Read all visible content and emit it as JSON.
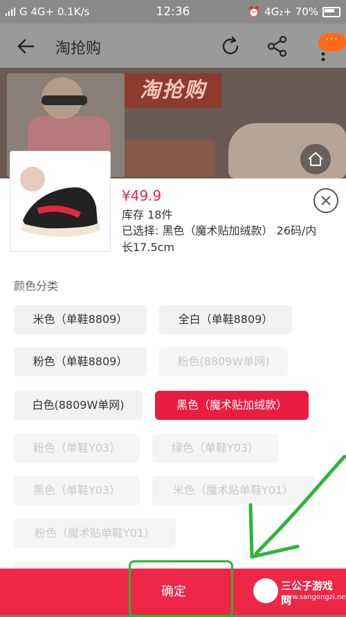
{
  "status": {
    "left_text": "G 4G+ 0.1K/s",
    "time": "12:36",
    "right_text": "4G₂+ 70%"
  },
  "header": {
    "title": "淘抢购"
  },
  "banner": {
    "logo_text": "淘抢购"
  },
  "product": {
    "price": "¥49.9",
    "stock": "库存 18件",
    "selected": "已选择: 黑色（魔术贴加绒款）  26码/内长17.5cm"
  },
  "section": {
    "label": "颜色分类"
  },
  "options": [
    {
      "label": "米色（单鞋8809）",
      "state": "normal"
    },
    {
      "label": "全白（单鞋8809）",
      "state": "normal"
    },
    {
      "label": "粉色（单鞋8809）",
      "state": "normal"
    },
    {
      "label": "粉色(8809W单网)",
      "state": "disabled"
    },
    {
      "label": "白色(8809W单网)",
      "state": "normal"
    },
    {
      "label": "黑色（魔术贴加绒款）",
      "state": "active"
    },
    {
      "label": "粉色（单鞋Y03）",
      "state": "disabled"
    },
    {
      "label": "绿色（单鞋Y03）",
      "state": "disabled"
    },
    {
      "label": "黑色（单鞋Y03）",
      "state": "disabled"
    },
    {
      "label": "米色（魔术贴单鞋Y01）",
      "state": "disabled"
    },
    {
      "label": "粉色（魔术贴单鞋Y01）",
      "state": "disabled"
    }
  ],
  "bottom": {
    "confirm_label": "确定"
  },
  "watermark": {
    "title": "三公子游戏网",
    "url": "www.sangongzi.net"
  },
  "colors": {
    "accent": "#ea1c40",
    "annotation": "#2bb53a"
  }
}
